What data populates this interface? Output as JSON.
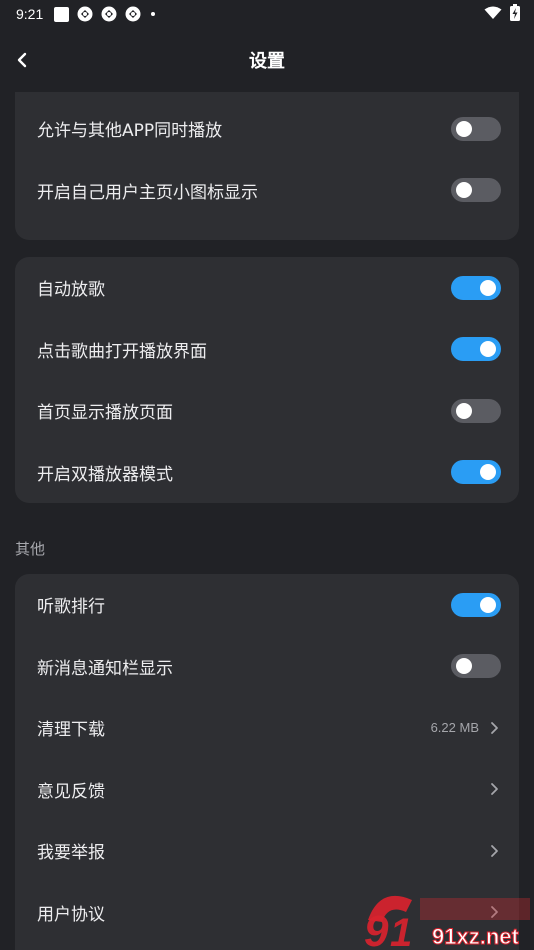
{
  "status_bar": {
    "time": "9:21",
    "icons": [
      "square-notification-icon",
      "app-icon",
      "app-icon",
      "app-icon",
      "more-dot-icon",
      "wifi-icon",
      "battery-charging-icon"
    ]
  },
  "header": {
    "back_icon": "chevron-left-icon",
    "title": "设置"
  },
  "colors": {
    "background": "#212226",
    "card": "#2e2f33",
    "toggle_on": "#2a9df4",
    "toggle_off": "#5b5c62"
  },
  "card_top": {
    "rows": [
      {
        "label": "允许与其他APP同时播放",
        "control": "toggle",
        "on": false
      },
      {
        "label": "开启自己用户主页小图标显示",
        "control": "toggle",
        "on": false
      }
    ]
  },
  "card_playback": {
    "rows": [
      {
        "label": "自动放歌",
        "control": "toggle",
        "on": true
      },
      {
        "label": "点击歌曲打开播放界面",
        "control": "toggle",
        "on": true
      },
      {
        "label": "首页显示播放页面",
        "control": "toggle",
        "on": false
      },
      {
        "label": "开启双播放器模式",
        "control": "toggle",
        "on": true
      }
    ]
  },
  "other_section": {
    "title": "其他",
    "rows": [
      {
        "label": "听歌排行",
        "control": "toggle",
        "on": true
      },
      {
        "label": "新消息通知栏显示",
        "control": "toggle",
        "on": false
      },
      {
        "label": "清理下载",
        "control": "arrow",
        "value": "6.22 MB"
      },
      {
        "label": "意见反馈",
        "control": "arrow"
      },
      {
        "label": "我要举报",
        "control": "arrow"
      },
      {
        "label": "用户协议",
        "control": "arrow"
      }
    ]
  },
  "watermark": {
    "text": "91xz.net"
  }
}
